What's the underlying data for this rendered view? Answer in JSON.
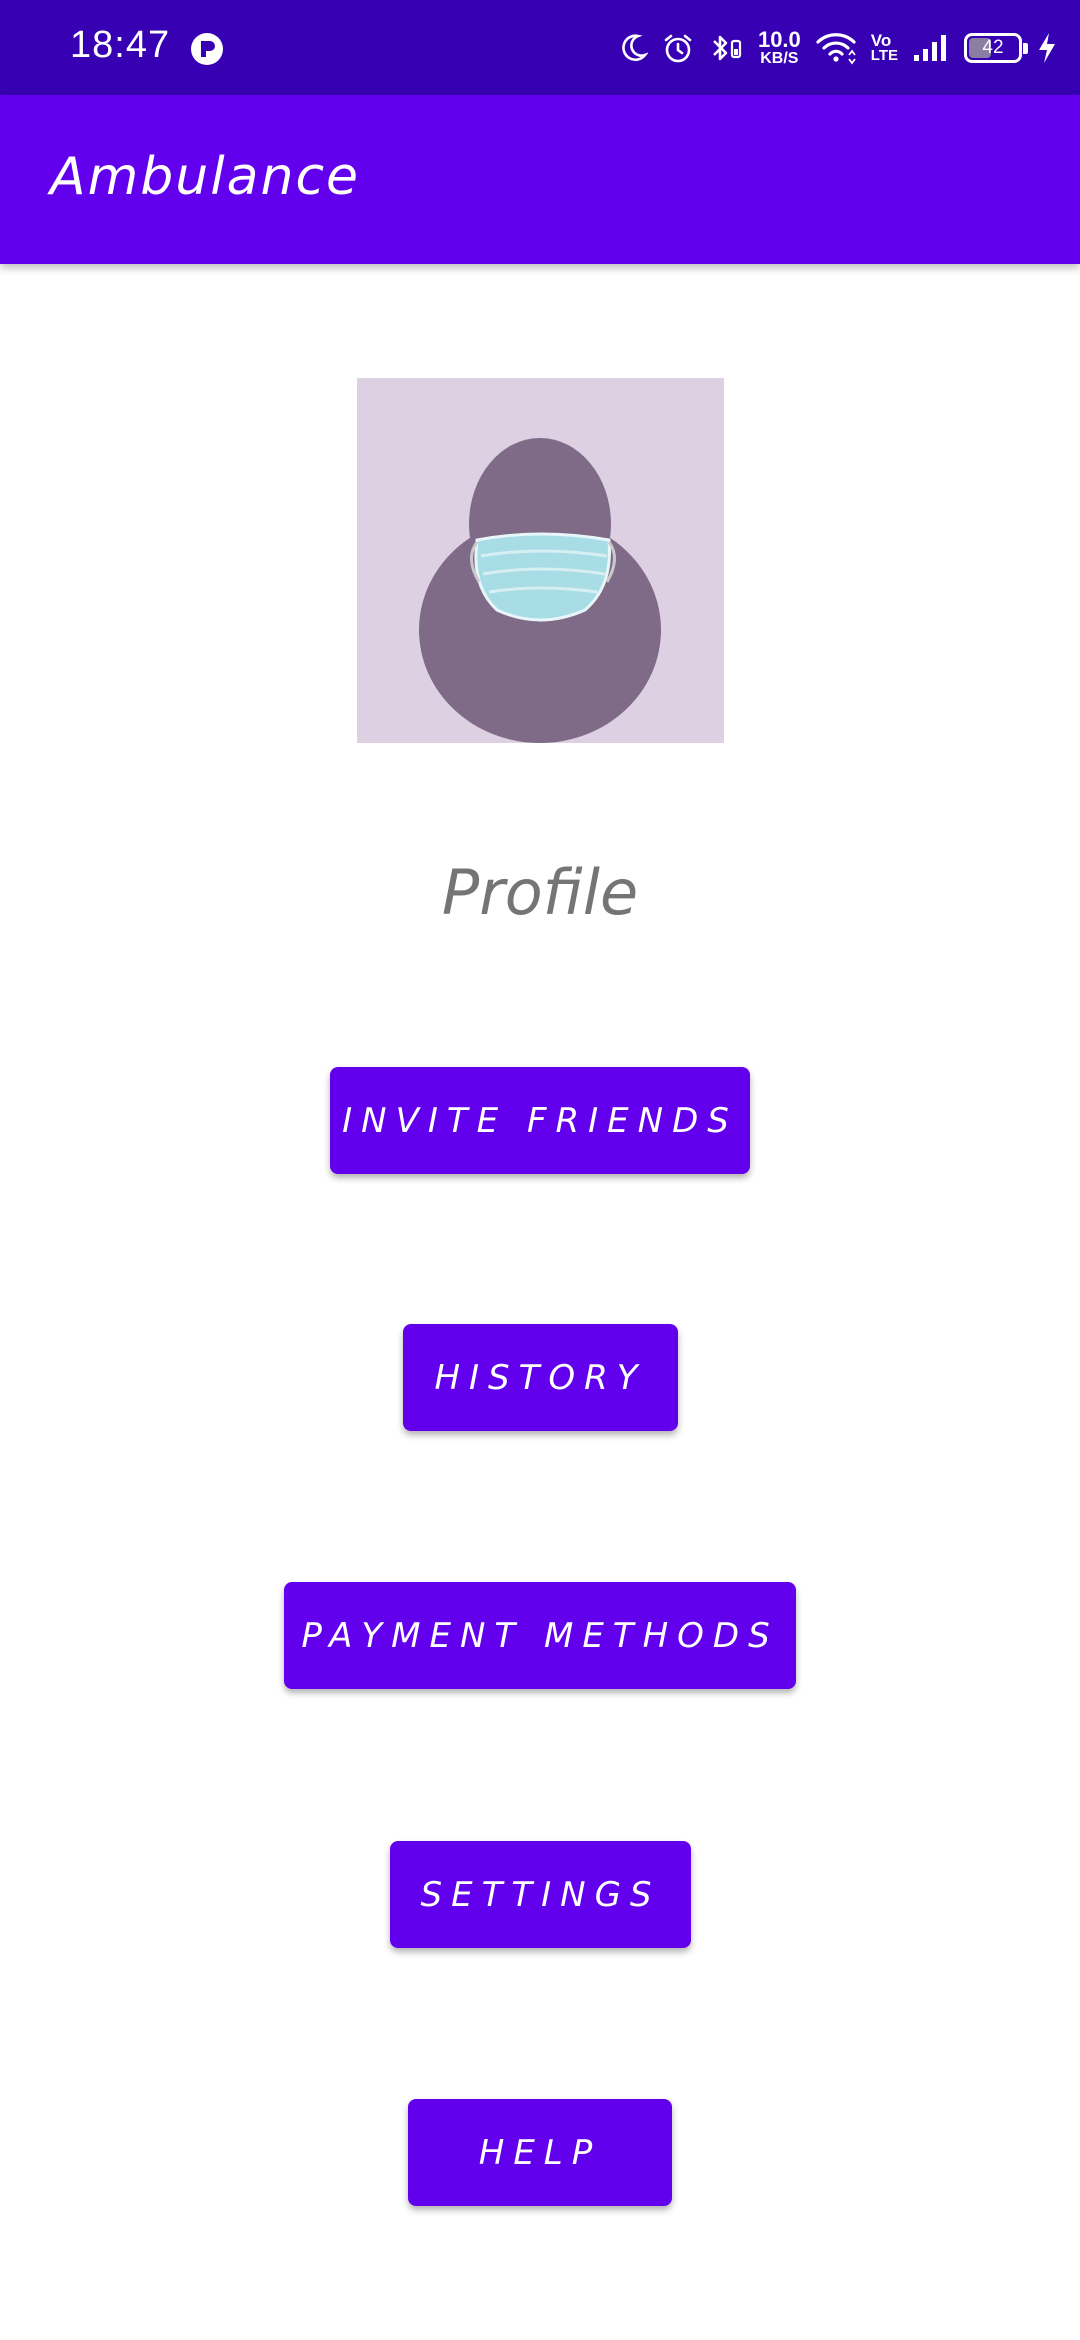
{
  "status_bar": {
    "time": "18:47",
    "net_speed_value": "10.0",
    "net_speed_unit": "KB/S",
    "volte_top": "Vo",
    "volte_bottom": "LTE",
    "battery_level": "42",
    "battery_fraction": 0.42,
    "icons": [
      "app-notification-icon",
      "moon-icon",
      "alarm-icon",
      "bluetooth-icon",
      "wifi-icon",
      "signal-icon",
      "battery-icon",
      "charging-icon"
    ]
  },
  "app_bar": {
    "title": "Ambulance"
  },
  "profile": {
    "label": "Profile",
    "avatar_icon": "masked-person-avatar"
  },
  "menu": {
    "buttons": [
      {
        "label": "INVITE FRIENDS"
      },
      {
        "label": "HISTORY"
      },
      {
        "label": "PAYMENT METHODS"
      },
      {
        "label": "SETTINGS"
      },
      {
        "label": "HELP"
      }
    ]
  },
  "colors": {
    "status_bar": "#3700B3",
    "primary": "#6200EE",
    "avatar_bg": "#DED0E3",
    "avatar_silhouette": "#7F6A87",
    "mask": "#A9DDE6",
    "profile_text": "#757575"
  }
}
